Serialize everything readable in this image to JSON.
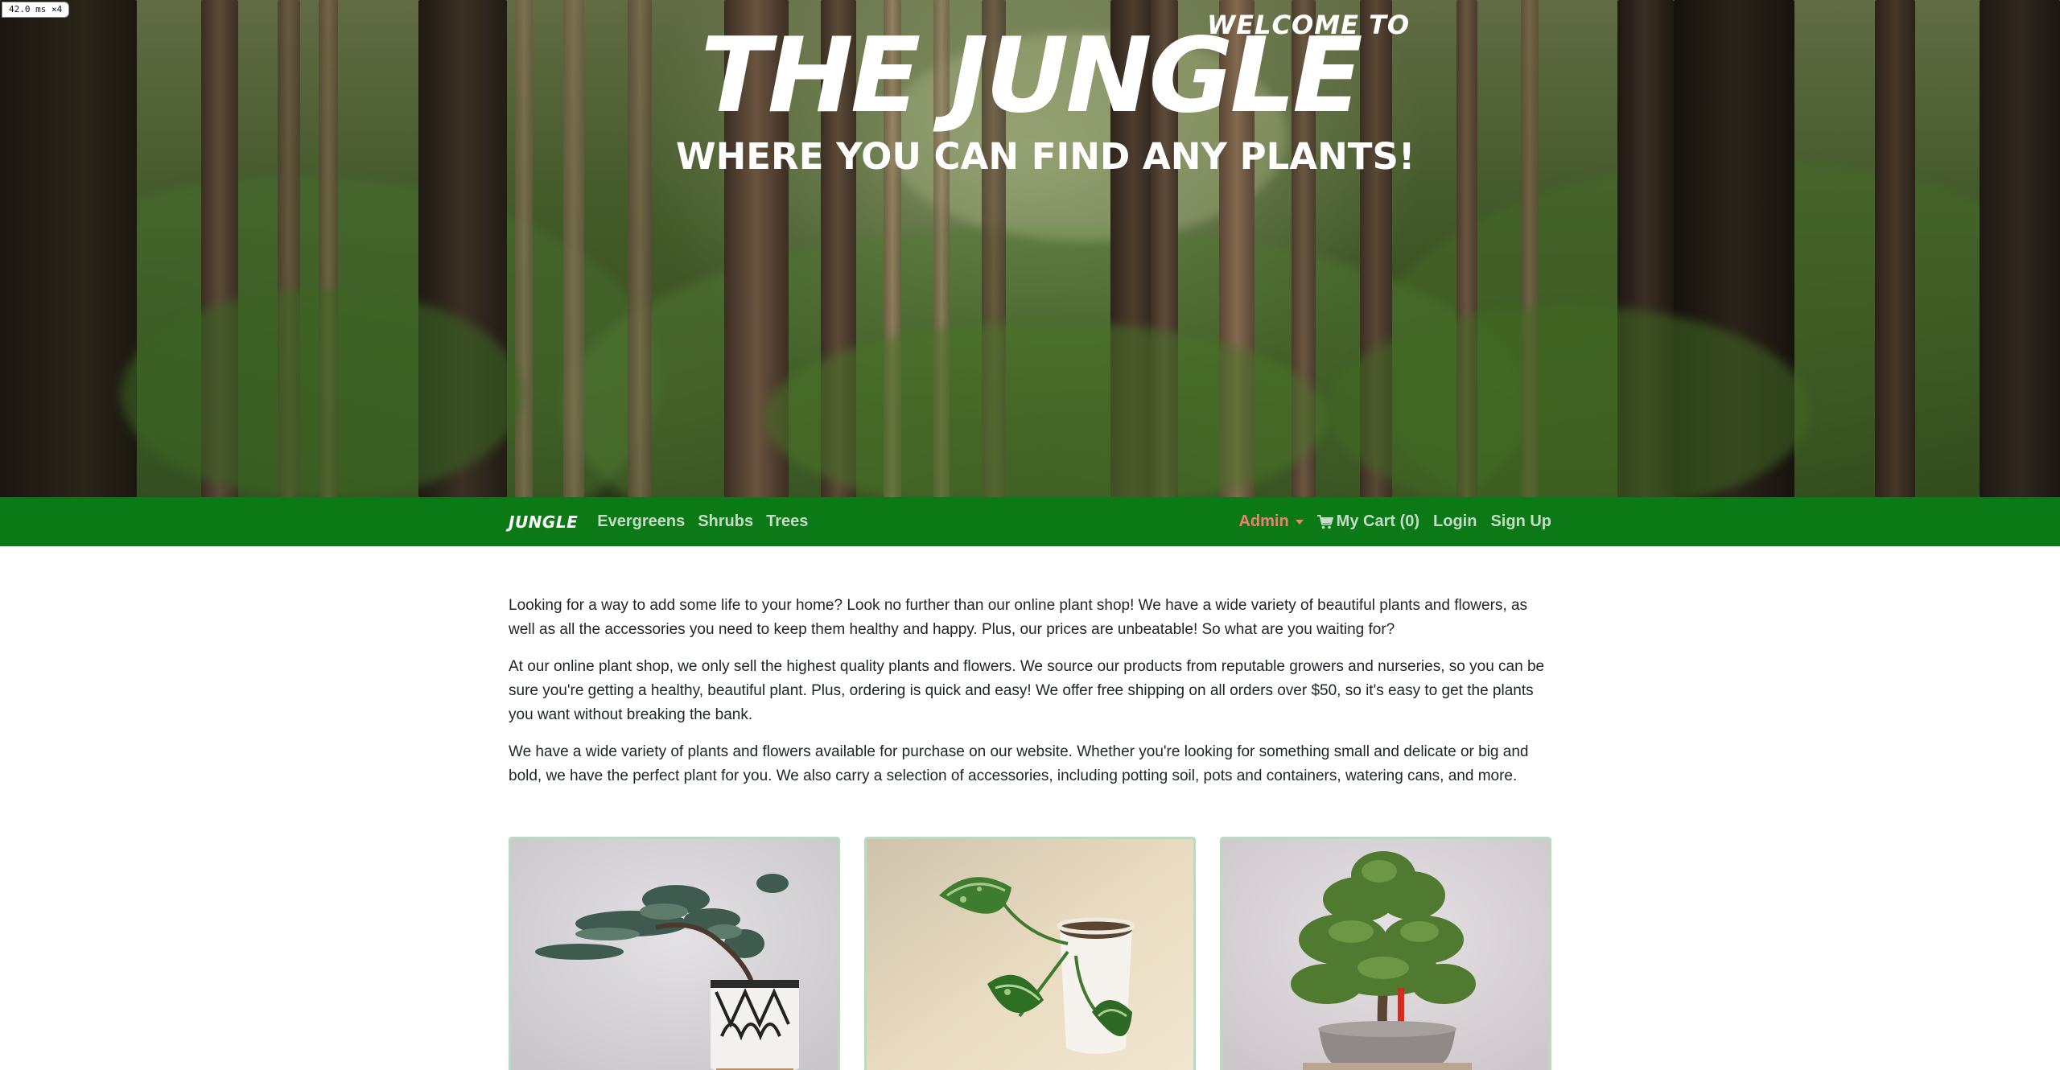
{
  "perf_badge": "42.0 ms ×4",
  "hero": {
    "welcome": "WELCOME TO",
    "title": "THE JUNGLE",
    "subtitle": "WHERE YOU CAN FIND ANY PLANTS!"
  },
  "navbar": {
    "brand": "JUNGLE",
    "links": [
      "Evergreens",
      "Shrubs",
      "Trees"
    ],
    "admin": "Admin",
    "cart": "My Cart (0)",
    "login": "Login",
    "signup": "Sign Up",
    "colors": {
      "background": "#0b7a16",
      "admin": "#f08070"
    }
  },
  "intro": {
    "paragraphs": [
      "Looking for a way to add some life to your home? Look no further than our online plant shop! We have a wide variety of beautiful plants and flowers, as well as all the accessories you need to keep them healthy and happy. Plus, our prices are unbeatable! So what are you waiting for?",
      "At our online plant shop, we only sell the highest quality plants and flowers. We source our products from reputable growers and nurseries, so you can be sure you're getting a healthy, beautiful plant. Plus, ordering is quick and easy! We offer free shipping on all orders over $50, so it's easy to get the plants you want without breaking the bank.",
      "We have a wide variety of plants and flowers available for purchase on our website. Whether you're looking for something small and delicate or big and bold, we have the perfect plant for you. We also carry a selection of accessories, including potting soil, pots and containers, watering cans, and more."
    ]
  },
  "products": [
    {
      "image": "juniper-bonsai-in-patterned-pot"
    },
    {
      "image": "pothos-in-white-cup"
    },
    {
      "image": "bonsai-tree-in-gray-pot"
    }
  ]
}
